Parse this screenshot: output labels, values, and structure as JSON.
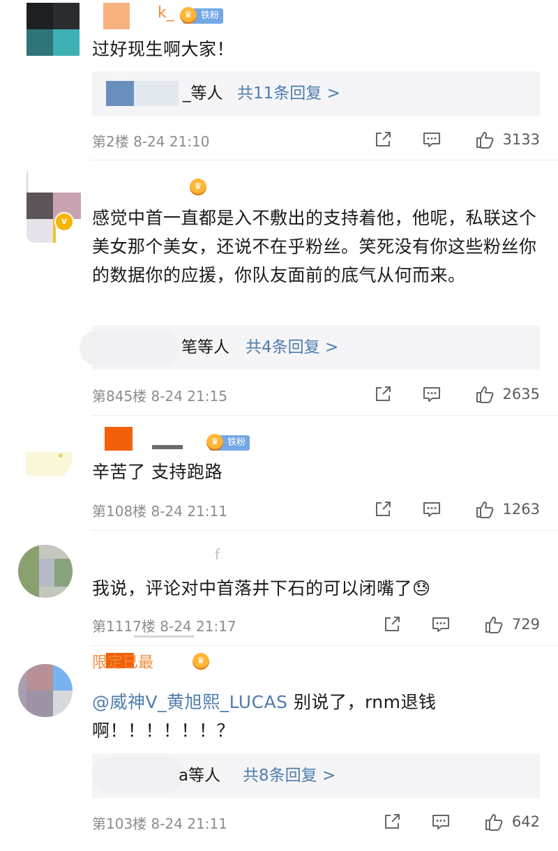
{
  "badges": {
    "fan": "铁粉",
    "crown_glyph": "♛",
    "verified_glyph": "v"
  },
  "icons": {
    "share": "share-icon",
    "comment": "comment-icon",
    "like": "thumbs-up-icon"
  },
  "colors": {
    "link": "#4f7cac",
    "meta": "#8c8c8c",
    "reply_bg": "#f5f5f7",
    "badge": "#73a7e6"
  },
  "comments": [
    {
      "name_fragment": "k_",
      "text": "过好现生啊大家！",
      "replies": {
        "who": "_等人",
        "total": "共11条回复 >"
      },
      "floor": "第2楼",
      "time": "8-24 21:10",
      "likes": "3133"
    },
    {
      "text": "感觉中首一直都是入不敷出的支持着他，他呢，私联这个美女那个美女，还说不在乎粉丝。笑死没有你这些粉丝你的数据你的应援，你队友面前的底气从何而来。",
      "replies": {
        "who": "笔等人",
        "total": "共4条回复 >"
      },
      "floor": "第845楼",
      "time": "8-24 21:15",
      "likes": "2635"
    },
    {
      "text": "辛苦了 支持跑路",
      "floor": "第108楼",
      "time": "8-24 21:11",
      "likes": "1263"
    },
    {
      "name_fragment": "f",
      "text": "我说，评论对中首落井下石的可以闭嘴了😓",
      "floor": "第1117楼",
      "time": "8-24 21:17",
      "likes": "729"
    },
    {
      "name_fragment": "限定已最",
      "mention": "@威神V_黄旭熙_LUCAS",
      "text": " 别说了，rnm退钱啊！！！！！！？",
      "replies": {
        "who": "a等人",
        "total": "共8条回复 >"
      },
      "floor": "第103楼",
      "time": "8-24 21:11",
      "likes": "642"
    }
  ]
}
